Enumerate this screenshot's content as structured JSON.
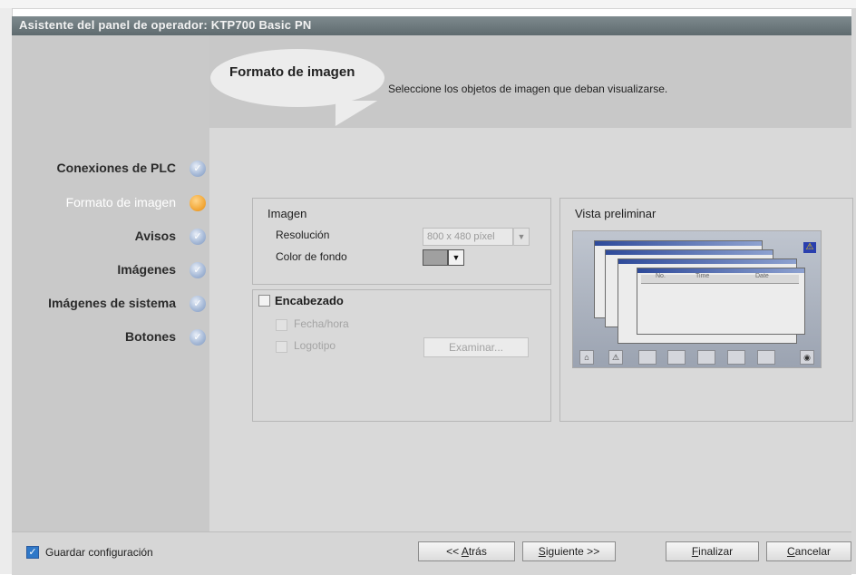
{
  "window": {
    "title": "Asistente del panel de operador: KTP700 Basic PN"
  },
  "header": {
    "step_title": "Formato de imagen",
    "subtitle": "Seleccione los objetos de imagen que deban visualizarse."
  },
  "nav": {
    "items": [
      {
        "label": "Conexiones de PLC",
        "state": "done"
      },
      {
        "label": "Formato de imagen",
        "state": "active"
      },
      {
        "label": "Avisos",
        "state": "done"
      },
      {
        "label": "Imágenes",
        "state": "done"
      },
      {
        "label": "Imágenes de sistema",
        "state": "done"
      },
      {
        "label": "Botones",
        "state": "done"
      }
    ],
    "check_glyph": "✓"
  },
  "imagen_group": {
    "title": "Imagen",
    "resolution_label": "Resolución",
    "resolution_value": "800 x 480 píxel",
    "background_label": "Color de fondo",
    "background_color": "#a0a0a0"
  },
  "encabezado_group": {
    "title": "Encabezado",
    "checked": false,
    "fecha_label": "Fecha/hora",
    "logotipo_label": "Logotipo",
    "browse_label": "Examinar..."
  },
  "preview": {
    "title": "Vista preliminar",
    "col_no": "No.",
    "col_time": "Time",
    "col_date": "Date"
  },
  "footer": {
    "save_config_label": "Guardar configuración",
    "save_config_checked": true,
    "back_pre": "<< ",
    "back_u": "A",
    "back_post": "trás",
    "next_u": "S",
    "next_post": "iguiente >>",
    "finish_u": "F",
    "finish_post": "inalizar",
    "cancel_u": "C",
    "cancel_post": "ancelar"
  },
  "colors": {
    "accent_orange": "#f3a93a",
    "check_blue": "#8fa6cc",
    "title_bar": "#6b777b"
  }
}
